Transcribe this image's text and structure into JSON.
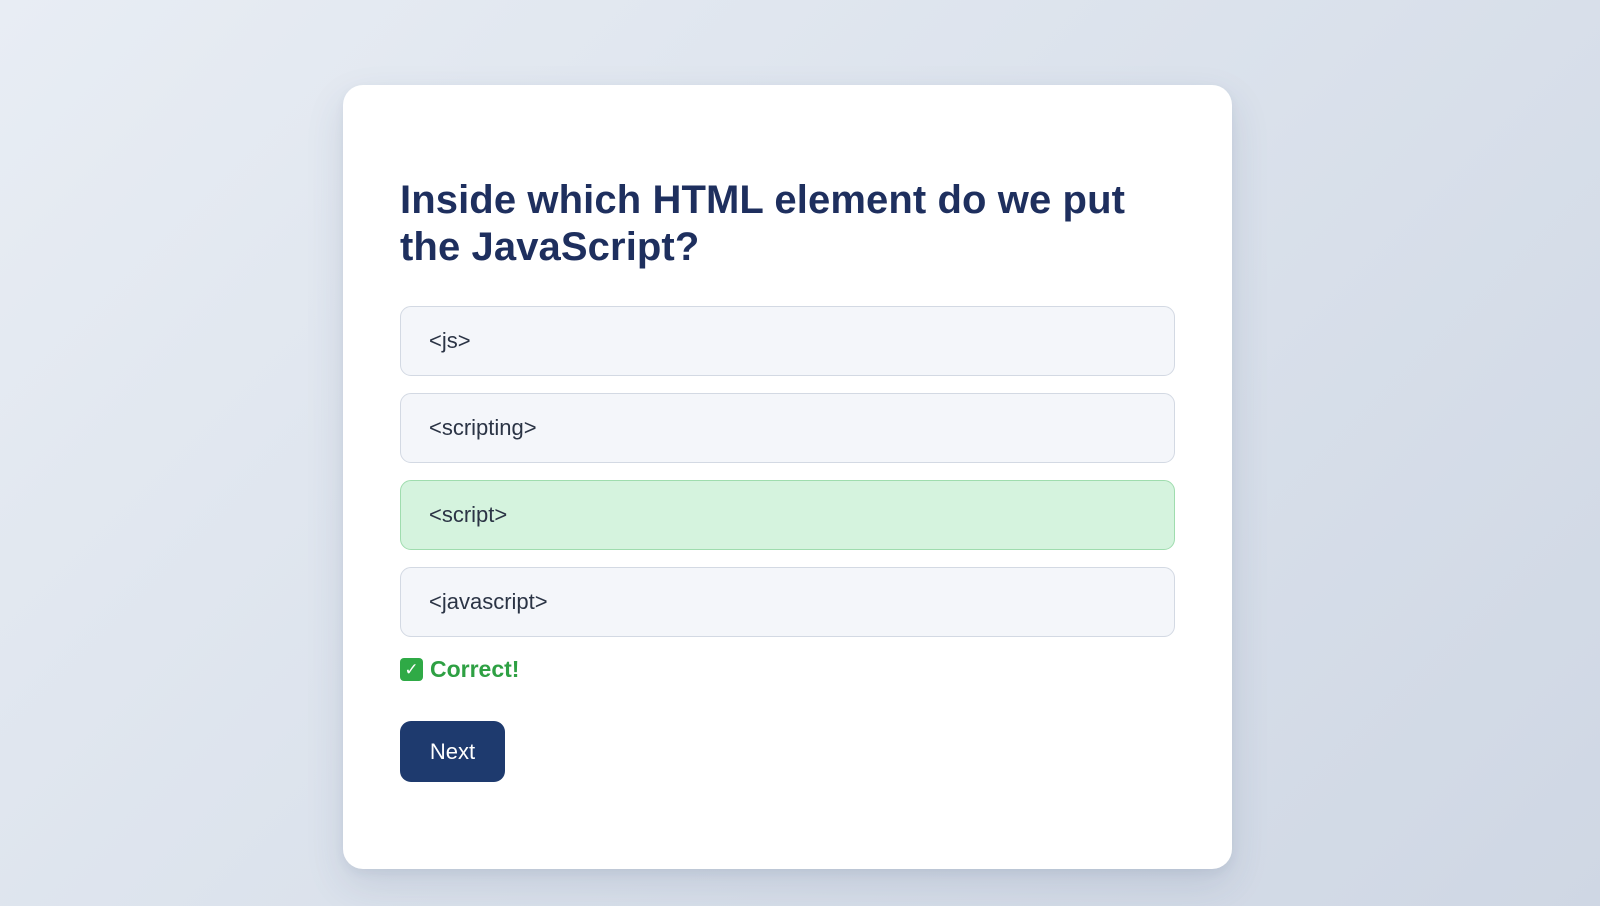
{
  "quiz": {
    "question": "Inside which HTML element do we put the JavaScript?",
    "options": [
      {
        "label": "<js>",
        "state": "default"
      },
      {
        "label": "<scripting>",
        "state": "default"
      },
      {
        "label": "<script>",
        "state": "correct"
      },
      {
        "label": "<javascript>",
        "state": "default"
      }
    ],
    "feedback": {
      "icon": "check-mark-icon",
      "text": "Correct!",
      "color": "#2ea043"
    },
    "next_label": "Next"
  },
  "colors": {
    "title": "#1e2f5e",
    "correct_bg": "#d5f3de",
    "button": "#1e3a6e"
  }
}
